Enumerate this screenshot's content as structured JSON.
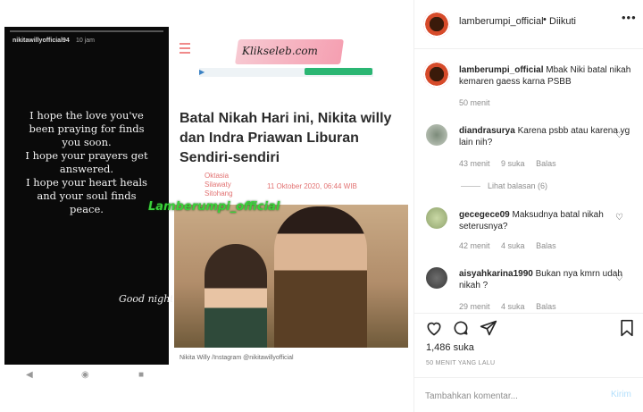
{
  "post": {
    "story": {
      "username": "nikitawillyofficial94",
      "time": "10 jam",
      "lines": [
        "I hope the love you've",
        "been praying for finds",
        "you soon.",
        "I hope your prayers get",
        "answered.",
        "I hope your heart heals",
        "and your soul finds",
        "peace."
      ],
      "closing": "Good night"
    },
    "article": {
      "site_logo": "Klikseleb.com",
      "title": "Batal Nikah Hari ini, Nikita willy dan Indra Priawan Liburan Sendiri-sendiri",
      "author_lines": [
        "Oktasia",
        "Silawaty",
        "Sitohang"
      ],
      "date": "11 Oktober 2020, 06:44 WIB",
      "photo_caption": "Nikita Willy /Instagram @nikitawillyofficial"
    },
    "watermark": "Lamberumpi_official"
  },
  "panel": {
    "username": "lamberumpi_official",
    "separator": "•",
    "follow_status": "Diikuti",
    "more_label": "•••",
    "caption": {
      "username": "lamberumpi_official",
      "text": "Mbak Niki batal nikah kemaren gaess karna PSBB",
      "time": "50 menit"
    },
    "comments": [
      {
        "username": "diandrasurya",
        "text": "Karena psbb atau karena yg lain nih?",
        "time": "43 menit",
        "likes": "9 suka",
        "reply": "Balas",
        "view_replies": "Lihat balasan (6)"
      },
      {
        "username": "gecegece09",
        "text": "Maksudnya batal nikah seterusnya?",
        "time": "42 menit",
        "likes": "4 suka",
        "reply": "Balas"
      },
      {
        "username": "aisyahkarina1990",
        "text": "Bukan nya kmrn udah nikah ?",
        "time": "29 menit",
        "likes": "4 suka",
        "reply": "Balas"
      }
    ],
    "likes": "1,486 suka",
    "posted_ago": "50 MENIT YANG LALU",
    "comment_placeholder": "Tambahkan komentar...",
    "post_label": "Kirim"
  }
}
